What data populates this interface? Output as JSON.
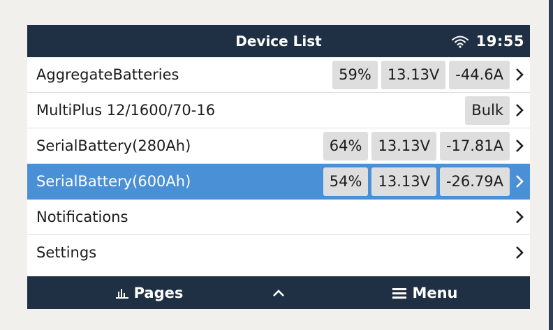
{
  "header": {
    "title": "Device List",
    "time": "19:55",
    "wifi_icon": "wifi-icon"
  },
  "rows": [
    {
      "label": "AggregateBatteries",
      "badges": [
        "59%",
        "13.13V",
        "-44.6A"
      ],
      "selected": false
    },
    {
      "label": "MultiPlus 12/1600/70-16",
      "badges": [
        "Bulk"
      ],
      "selected": false
    },
    {
      "label": "SerialBattery(280Ah)",
      "badges": [
        "64%",
        "13.13V",
        "-17.81A"
      ],
      "selected": false
    },
    {
      "label": "SerialBattery(600Ah)",
      "badges": [
        "54%",
        "13.13V",
        "-26.79A"
      ],
      "selected": true
    },
    {
      "label": "Notifications",
      "badges": [],
      "selected": false
    },
    {
      "label": "Settings",
      "badges": [],
      "selected": false
    }
  ],
  "footer": {
    "pages_label": "Pages",
    "up_label": "^",
    "menu_label": "Menu"
  },
  "colors": {
    "header_bg": "#1f3044",
    "selected_bg": "#4a90d6",
    "badge_bg": "#dedede",
    "page_bg": "#f1f0ed"
  }
}
